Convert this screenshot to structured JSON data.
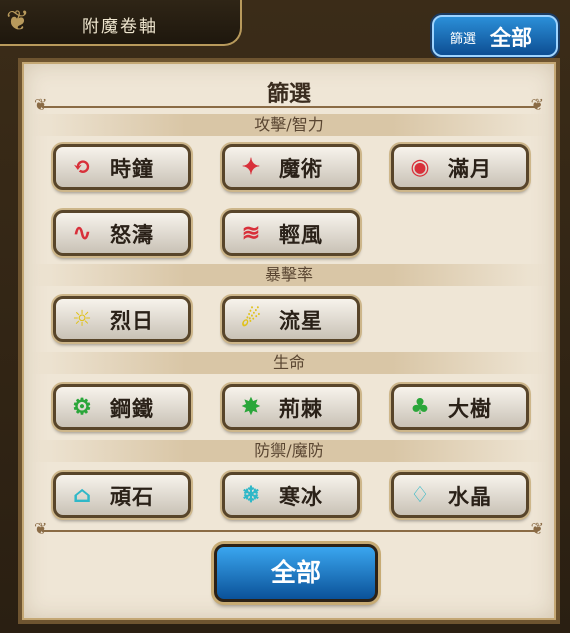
{
  "header": {
    "title": "附魔卷軸"
  },
  "filter_pill": {
    "label_small": "篩選",
    "label_big": "全部"
  },
  "panel": {
    "title": "篩選"
  },
  "sections": [
    {
      "label": "攻擊/智力"
    },
    {
      "label": "暴擊率"
    },
    {
      "label": "生命"
    },
    {
      "label": "防禦/魔防"
    }
  ],
  "buttons": [
    {
      "label": "時鐘",
      "icon": "clock-icon",
      "color": "#d8303a"
    },
    {
      "label": "魔術",
      "icon": "magic-star-icon",
      "color": "#d8303a"
    },
    {
      "label": "滿月",
      "icon": "full-moon-icon",
      "color": "#d8303a"
    },
    {
      "label": "怒濤",
      "icon": "waves-icon",
      "color": "#d8303a"
    },
    {
      "label": "輕風",
      "icon": "wind-icon",
      "color": "#d8303a"
    },
    {
      "label": "烈日",
      "icon": "sun-icon",
      "color": "#e0c21a"
    },
    {
      "label": "流星",
      "icon": "meteor-icon",
      "color": "#e0c21a"
    },
    {
      "label": "鋼鐵",
      "icon": "gear-icon",
      "color": "#2aa63a"
    },
    {
      "label": "荊棘",
      "icon": "thorn-icon",
      "color": "#2aa63a"
    },
    {
      "label": "大樹",
      "icon": "tree-icon",
      "color": "#2aa63a"
    },
    {
      "label": "頑石",
      "icon": "rock-icon",
      "color": "#2fb8c8"
    },
    {
      "label": "寒冰",
      "icon": "snowflake-icon",
      "color": "#2fb8c8"
    },
    {
      "label": "水晶",
      "icon": "crystal-icon",
      "color": "#2fb8c8"
    }
  ],
  "all_button": {
    "label": "全部"
  }
}
